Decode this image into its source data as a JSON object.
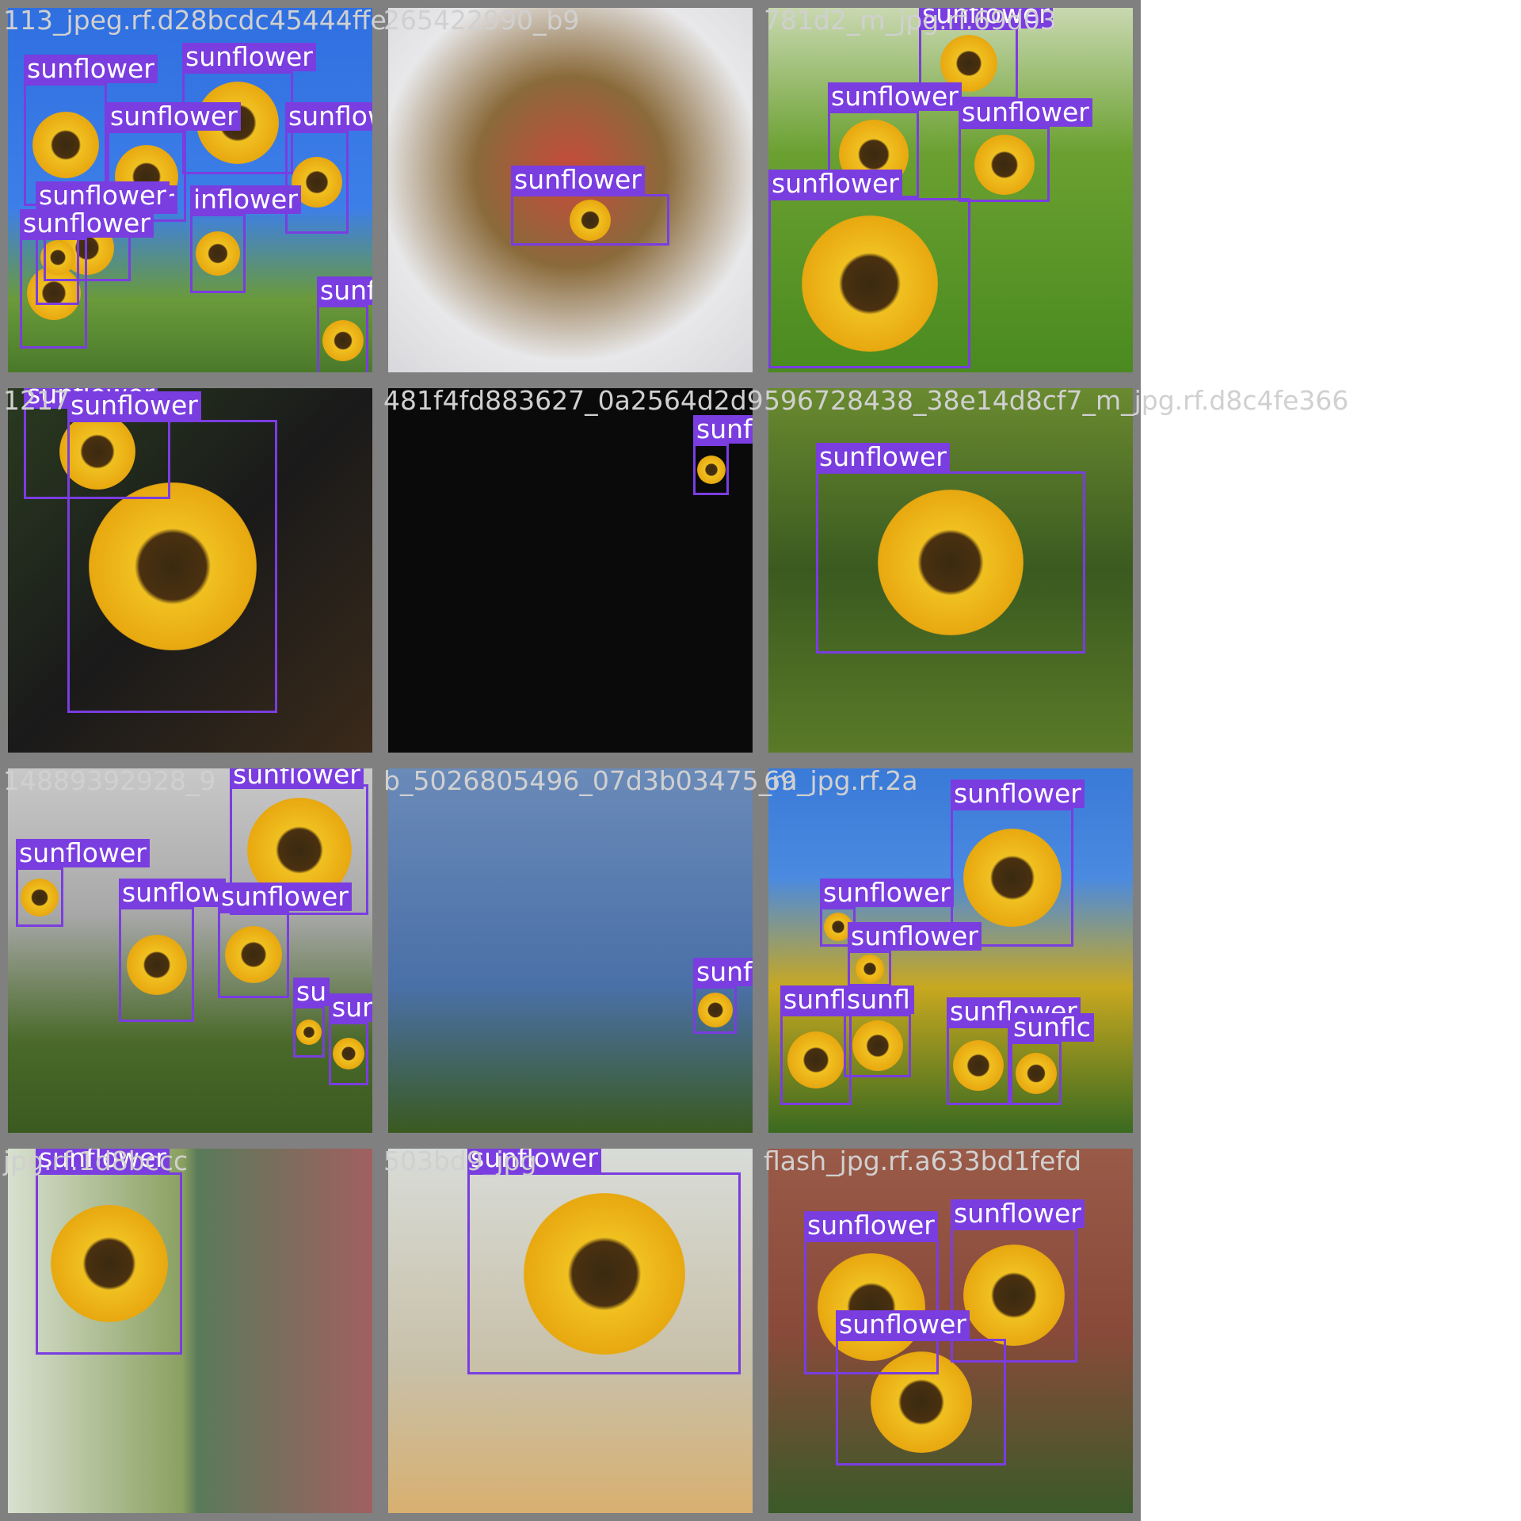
{
  "title": "",
  "label_color": "#7a3de0",
  "tiles": [
    {
      "name": "tile-r1c1",
      "filename": "113_jpeg.rf.d28bcdc45444ffe",
      "scene": "sunflower-field-sky",
      "bg": "linear-gradient(180deg,#2f6fe0 0%,#3d7fe8 55%,#6a9a3a 80%,#4a7a2a 100%)",
      "labels": [
        "sunflower",
        "sunflower",
        "sunflower",
        "sunflower",
        "sunflower",
        "inflower",
        "sunflower",
        "sunflower",
        "sunflower"
      ]
    },
    {
      "name": "tile-r1c2",
      "filename": "265422990_b9",
      "scene": "flower-bouquet",
      "bg": "radial-gradient(circle at 50% 45%,#c84a3a 0%,#8a6a3a 35%,#e8e8ea 70%,#d8d8dc 100%)",
      "labels": [
        "sunflower"
      ]
    },
    {
      "name": "tile-r1c3",
      "filename": "781d2_m_jpg.rf.69d03",
      "scene": "blurred-field",
      "bg": "linear-gradient(180deg,#c9d8b0 0%,#6aa030 40%,#4a8a20 100%)",
      "labels": [
        "sunflower",
        "sunflower",
        "sunflower",
        "sunflower"
      ]
    },
    {
      "name": "tile-r2c1",
      "filename": "1217",
      "scene": "big-sunflower",
      "bg": "linear-gradient(135deg,#2a3a20 0%,#1a1a1a 50%,#3a2a1a 100%)",
      "labels": [
        "sunflower",
        "sunflower"
      ]
    },
    {
      "name": "tile-r2c2",
      "filename": "481f4fd883627_0a2564d2d9",
      "scene": "noise-mosaic",
      "bg": "#0a0a0a",
      "labels": [
        "sunflower"
      ]
    },
    {
      "name": "tile-r2c3",
      "filename": "596728438_38e14d8cf7_m_jpg.rf.d8c4fe366",
      "scene": "drooping-sunflower",
      "bg": "linear-gradient(180deg,#6a8a30 0%,#3a5a20 50%,#5a7a28 100%)",
      "labels": [
        "sunflower"
      ]
    },
    {
      "name": "tile-r3c1",
      "filename": "14889392928_9",
      "scene": "house-sunflowers",
      "bg": "linear-gradient(180deg,#c8c8c8 0%,#a8a8a8 40%,#4a6a2a 75%,#3a5a20 100%)",
      "labels": [
        "sunflower",
        "sunflower",
        "sunflow",
        "sunflower",
        "su",
        "sunflower"
      ]
    },
    {
      "name": "tile-r3c2",
      "filename": "b_5026805496_07d3b03475_m",
      "scene": "sky-noise",
      "bg": "linear-gradient(180deg,#6a8ab8 0%,#4a70a8 60%,#3a5a20 100%)",
      "labels": [
        "sunflower"
      ]
    },
    {
      "name": "tile-r3c3",
      "filename": "69_jpg.rf.2a",
      "scene": "sunflower-field-cloud",
      "bg": "linear-gradient(180deg,#3a7ad8 0%,#4a8ae0 30%,#c8a820 60%,#3a6a20 100%)",
      "labels": [
        "sunflower",
        "sunflower",
        "sunflower",
        "sunflower",
        "sunfl",
        "sunflower",
        "sunflc",
        "sunflower"
      ]
    },
    {
      "name": "tile-r4c1",
      "filename": "jpg.rf.1d8bccc",
      "scene": "two-sunflower-images",
      "bg": "linear-gradient(90deg,#d8e0d0 0%,#8aa060 48%,#5a7a5a 52%,#a06060 100%)",
      "labels": [
        "sunflower"
      ]
    },
    {
      "name": "tile-r4c2",
      "filename": "503bd9_jpg",
      "scene": "blurred-vase",
      "bg": "linear-gradient(180deg,#d8dcd8 0%,#c8c0a8 60%,#d8b070 100%)",
      "labels": [
        "sunflower"
      ]
    },
    {
      "name": "tile-r4c3",
      "filename": "flash_jpg.rf.a633bd1fefd",
      "scene": "brick-wall-sunflowers",
      "bg": "linear-gradient(180deg,#9a5a48 0%,#8a4a3a 50%,#3a5a28 100%)",
      "labels": [
        "sunflower",
        "sunflower",
        "sunflower"
      ]
    }
  ]
}
